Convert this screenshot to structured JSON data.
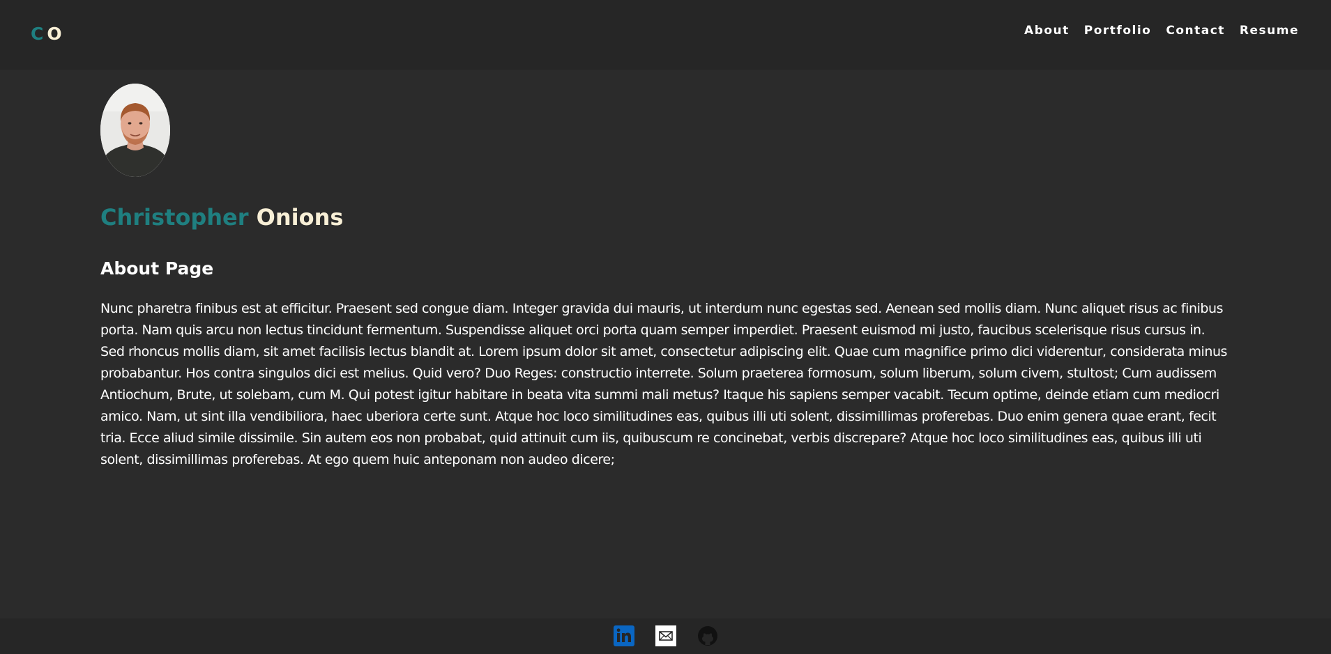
{
  "header": {
    "logo": {
      "first": "C",
      "second": "O"
    },
    "nav": [
      {
        "label": "About"
      },
      {
        "label": "Portfolio"
      },
      {
        "label": "Contact"
      },
      {
        "label": "Resume"
      }
    ]
  },
  "profile": {
    "first_name": "Christopher",
    "last_name": "Onions"
  },
  "about": {
    "heading": "About Page",
    "body": "Nunc pharetra finibus est at efficitur. Praesent sed congue diam. Integer gravida dui mauris, ut interdum nunc egestas sed. Aenean sed mollis diam. Nunc aliquet risus ac finibus porta. Nam quis arcu non lectus tincidunt fermentum. Suspendisse aliquet orci porta quam semper imperdiet. Praesent euismod mi justo, faucibus scelerisque risus cursus in. Sed rhoncus mollis diam, sit amet facilisis lectus blandit at. Lorem ipsum dolor sit amet, consectetur adipiscing elit. Quae cum magnifice primo dici viderentur, considerata minus probabantur. Hos contra singulos dici est melius. Quid vero? Duo Reges: constructio interrete. Solum praeterea formosum, solum liberum, solum civem, stultost; Cum audissem Antiochum, Brute, ut solebam, cum M. Qui potest igitur habitare in beata vita summi mali metus? Itaque his sapiens semper vacabit. Tecum optime, deinde etiam cum mediocri amico. Nam, ut sint illa vendibiliora, haec uberiora certe sunt. Atque hoc loco similitudines eas, quibus illi uti solent, dissimillimas proferebas. Duo enim genera quae erant, fecit tria. Ecce aliud simile dissimile. Sin autem eos non probabat, quid attinuit cum iis, quibuscum re concinebat, verbis discrepare? Atque hoc loco similitudines eas, quibus illi uti solent, dissimillimas proferebas. At ego quem huic anteponam non audeo dicere;"
  },
  "footer": {
    "icons": [
      "linkedin-icon",
      "email-icon",
      "github-icon"
    ]
  },
  "colors": {
    "background": "#2b2b2b",
    "header_bg": "#262626",
    "accent_teal": "#1f7f80",
    "accent_cream": "#f8efd6",
    "linkedin_blue": "#0a66c2"
  }
}
